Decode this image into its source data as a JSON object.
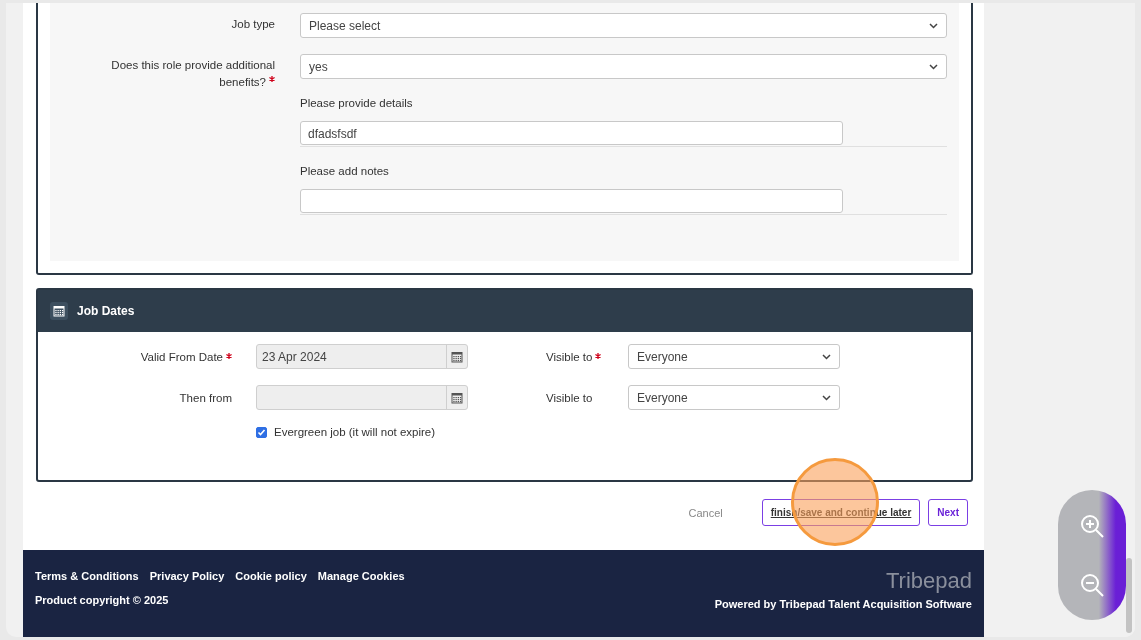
{
  "benefits_section": {
    "fields": [
      {
        "kind": "select",
        "label": "Job type",
        "required": false,
        "value": "Please select"
      },
      {
        "kind": "select",
        "label": "Does this role provide additional benefits?",
        "required": true,
        "value": "yes",
        "subfields": [
          {
            "label": "Please provide details",
            "value": "dfadsfsdf"
          },
          {
            "label": "Please add notes"
          }
        ]
      }
    ]
  },
  "job_dates": {
    "title": "Job Dates",
    "rows": [
      {
        "date_label": "Valid From Date",
        "required": true,
        "date_value": "23 Apr 2024",
        "visibility_label": "Visible to",
        "visibility_required": true,
        "visibility_value": "Everyone"
      },
      {
        "date_label": "Then from",
        "required": false,
        "visibility_label": "Visible to",
        "visibility_required": false,
        "visibility_value": "Everyone"
      }
    ],
    "evergreen": {
      "label": "Evergreen job (it will not expire)",
      "checked": true
    }
  },
  "actions": [
    {
      "kind": "plain",
      "label": "Cancel"
    },
    {
      "kind": "link",
      "label": "finish/save and continue later"
    },
    {
      "kind": "primary",
      "label": "Next"
    }
  ],
  "footer": {
    "links": [
      "Terms & Conditions",
      "Privacy Policy",
      "Cookie policy",
      "Manage Cookies"
    ],
    "copyright": "Product copyright © 2025",
    "brand": "Tribepad",
    "powered_by": "Powered by Tribepad Talent Acquisition Software"
  }
}
